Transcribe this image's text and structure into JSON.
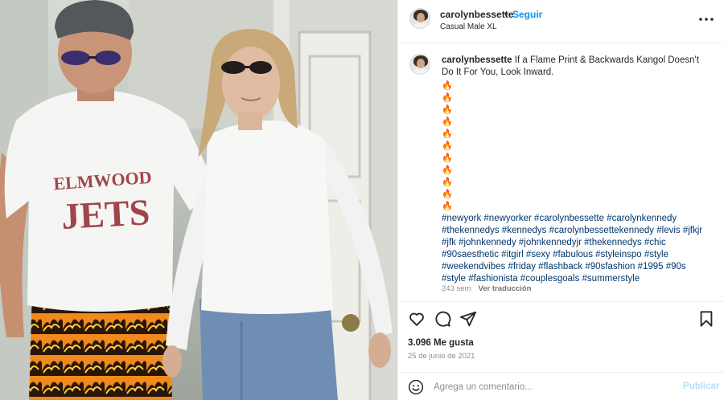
{
  "header": {
    "username": "carolynbessette",
    "dot": "•",
    "follow_label": "Seguir",
    "subtitle": "Casual Male XL",
    "more_icon": "more-horizontal-icon"
  },
  "caption": {
    "username": "carolynbessette",
    "text": "If a Flame Print & Backwards Kangol Doesn't Do It For You, Look Inward.",
    "flames": [
      "🔥",
      "🔥",
      "🔥",
      "🔥",
      "🔥",
      "🔥",
      "🔥",
      "🔥",
      "🔥",
      "🔥",
      "🔥"
    ],
    "hashtags": "#newyork #newyorker #carolynbessette #carolynkennedy #thekennedys #kennedys #carolynbessettekennedy #levis #jfkjr #jfk #johnkennedy #johnkennedyjr #thekennedys #chic #90saesthetic #itgirl #sexy #fabulous #styleinspo #style #weekendvibes #friday #flashback #90sfashion #1995 #90s #style #fashionista #couplesgoals #summerstyle",
    "age": "243 sem",
    "translate_label": "Ver traducción"
  },
  "actions": {
    "icons": [
      "heart-icon",
      "comment-icon",
      "share-icon",
      "bookmark-icon"
    ],
    "likes": "3.096 Me gusta",
    "date": "25 de junio de 2021"
  },
  "comment": {
    "placeholder": "Agrega un comentario...",
    "publish_label": "Publicar"
  },
  "photo": {
    "shirt_text_line1": "ELMWOOD",
    "shirt_text_line2": "JETS"
  },
  "colors": {
    "accent": "#0095f6",
    "link": "#00376b",
    "muted": "#8e8e8e",
    "publish_disabled": "#b2dffc"
  }
}
